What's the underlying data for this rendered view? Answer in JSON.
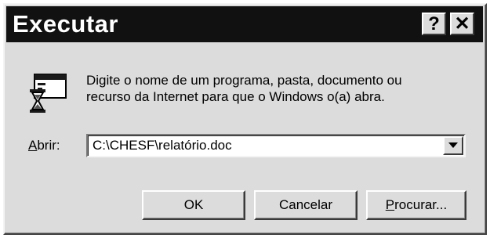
{
  "window": {
    "title": "Executar",
    "help_glyph": "?",
    "close_glyph": "✕"
  },
  "icon": "run-program-icon",
  "description": {
    "line1": "Digite o nome de um programa, pasta, documento ou",
    "line2": "recurso da Internet para que o Windows o(a) abra."
  },
  "open_field": {
    "label_mnemonic": "A",
    "label_rest": "brir:",
    "value": "C:\\CHESF\\relatório.doc"
  },
  "buttons": {
    "ok": "OK",
    "cancel": "Cancelar",
    "browse_mnemonic": "P",
    "browse_rest": "rocurar..."
  }
}
